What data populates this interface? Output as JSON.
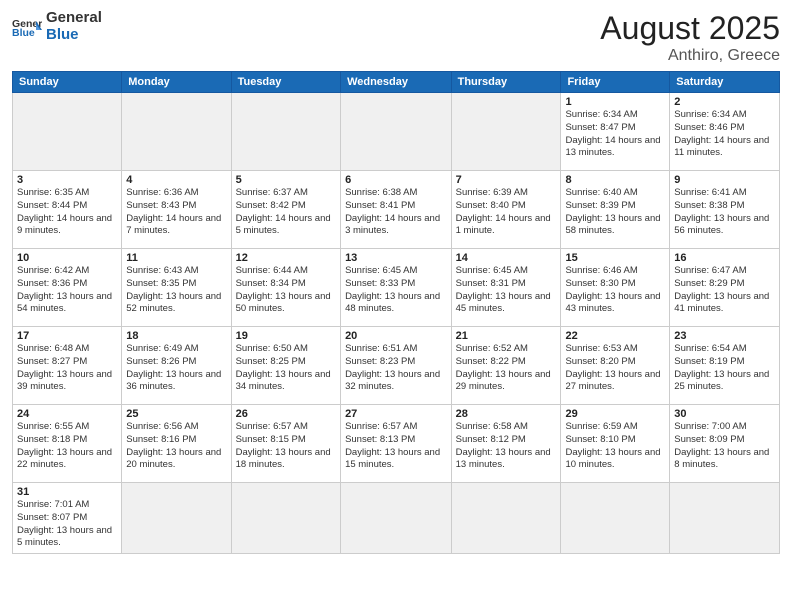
{
  "header": {
    "logo_general": "General",
    "logo_blue": "Blue",
    "title": "August 2025",
    "subtitle": "Anthiro, Greece"
  },
  "days_of_week": [
    "Sunday",
    "Monday",
    "Tuesday",
    "Wednesday",
    "Thursday",
    "Friday",
    "Saturday"
  ],
  "weeks": [
    [
      {
        "day": "",
        "info": ""
      },
      {
        "day": "",
        "info": ""
      },
      {
        "day": "",
        "info": ""
      },
      {
        "day": "",
        "info": ""
      },
      {
        "day": "",
        "info": ""
      },
      {
        "day": "1",
        "info": "Sunrise: 6:34 AM\nSunset: 8:47 PM\nDaylight: 14 hours and 13 minutes."
      },
      {
        "day": "2",
        "info": "Sunrise: 6:34 AM\nSunset: 8:46 PM\nDaylight: 14 hours and 11 minutes."
      }
    ],
    [
      {
        "day": "3",
        "info": "Sunrise: 6:35 AM\nSunset: 8:44 PM\nDaylight: 14 hours and 9 minutes."
      },
      {
        "day": "4",
        "info": "Sunrise: 6:36 AM\nSunset: 8:43 PM\nDaylight: 14 hours and 7 minutes."
      },
      {
        "day": "5",
        "info": "Sunrise: 6:37 AM\nSunset: 8:42 PM\nDaylight: 14 hours and 5 minutes."
      },
      {
        "day": "6",
        "info": "Sunrise: 6:38 AM\nSunset: 8:41 PM\nDaylight: 14 hours and 3 minutes."
      },
      {
        "day": "7",
        "info": "Sunrise: 6:39 AM\nSunset: 8:40 PM\nDaylight: 14 hours and 1 minute."
      },
      {
        "day": "8",
        "info": "Sunrise: 6:40 AM\nSunset: 8:39 PM\nDaylight: 13 hours and 58 minutes."
      },
      {
        "day": "9",
        "info": "Sunrise: 6:41 AM\nSunset: 8:38 PM\nDaylight: 13 hours and 56 minutes."
      }
    ],
    [
      {
        "day": "10",
        "info": "Sunrise: 6:42 AM\nSunset: 8:36 PM\nDaylight: 13 hours and 54 minutes."
      },
      {
        "day": "11",
        "info": "Sunrise: 6:43 AM\nSunset: 8:35 PM\nDaylight: 13 hours and 52 minutes."
      },
      {
        "day": "12",
        "info": "Sunrise: 6:44 AM\nSunset: 8:34 PM\nDaylight: 13 hours and 50 minutes."
      },
      {
        "day": "13",
        "info": "Sunrise: 6:45 AM\nSunset: 8:33 PM\nDaylight: 13 hours and 48 minutes."
      },
      {
        "day": "14",
        "info": "Sunrise: 6:45 AM\nSunset: 8:31 PM\nDaylight: 13 hours and 45 minutes."
      },
      {
        "day": "15",
        "info": "Sunrise: 6:46 AM\nSunset: 8:30 PM\nDaylight: 13 hours and 43 minutes."
      },
      {
        "day": "16",
        "info": "Sunrise: 6:47 AM\nSunset: 8:29 PM\nDaylight: 13 hours and 41 minutes."
      }
    ],
    [
      {
        "day": "17",
        "info": "Sunrise: 6:48 AM\nSunset: 8:27 PM\nDaylight: 13 hours and 39 minutes."
      },
      {
        "day": "18",
        "info": "Sunrise: 6:49 AM\nSunset: 8:26 PM\nDaylight: 13 hours and 36 minutes."
      },
      {
        "day": "19",
        "info": "Sunrise: 6:50 AM\nSunset: 8:25 PM\nDaylight: 13 hours and 34 minutes."
      },
      {
        "day": "20",
        "info": "Sunrise: 6:51 AM\nSunset: 8:23 PM\nDaylight: 13 hours and 32 minutes."
      },
      {
        "day": "21",
        "info": "Sunrise: 6:52 AM\nSunset: 8:22 PM\nDaylight: 13 hours and 29 minutes."
      },
      {
        "day": "22",
        "info": "Sunrise: 6:53 AM\nSunset: 8:20 PM\nDaylight: 13 hours and 27 minutes."
      },
      {
        "day": "23",
        "info": "Sunrise: 6:54 AM\nSunset: 8:19 PM\nDaylight: 13 hours and 25 minutes."
      }
    ],
    [
      {
        "day": "24",
        "info": "Sunrise: 6:55 AM\nSunset: 8:18 PM\nDaylight: 13 hours and 22 minutes."
      },
      {
        "day": "25",
        "info": "Sunrise: 6:56 AM\nSunset: 8:16 PM\nDaylight: 13 hours and 20 minutes."
      },
      {
        "day": "26",
        "info": "Sunrise: 6:57 AM\nSunset: 8:15 PM\nDaylight: 13 hours and 18 minutes."
      },
      {
        "day": "27",
        "info": "Sunrise: 6:57 AM\nSunset: 8:13 PM\nDaylight: 13 hours and 15 minutes."
      },
      {
        "day": "28",
        "info": "Sunrise: 6:58 AM\nSunset: 8:12 PM\nDaylight: 13 hours and 13 minutes."
      },
      {
        "day": "29",
        "info": "Sunrise: 6:59 AM\nSunset: 8:10 PM\nDaylight: 13 hours and 10 minutes."
      },
      {
        "day": "30",
        "info": "Sunrise: 7:00 AM\nSunset: 8:09 PM\nDaylight: 13 hours and 8 minutes."
      }
    ],
    [
      {
        "day": "31",
        "info": "Sunrise: 7:01 AM\nSunset: 8:07 PM\nDaylight: 13 hours and 5 minutes."
      },
      {
        "day": "",
        "info": ""
      },
      {
        "day": "",
        "info": ""
      },
      {
        "day": "",
        "info": ""
      },
      {
        "day": "",
        "info": ""
      },
      {
        "day": "",
        "info": ""
      },
      {
        "day": "",
        "info": ""
      }
    ]
  ]
}
